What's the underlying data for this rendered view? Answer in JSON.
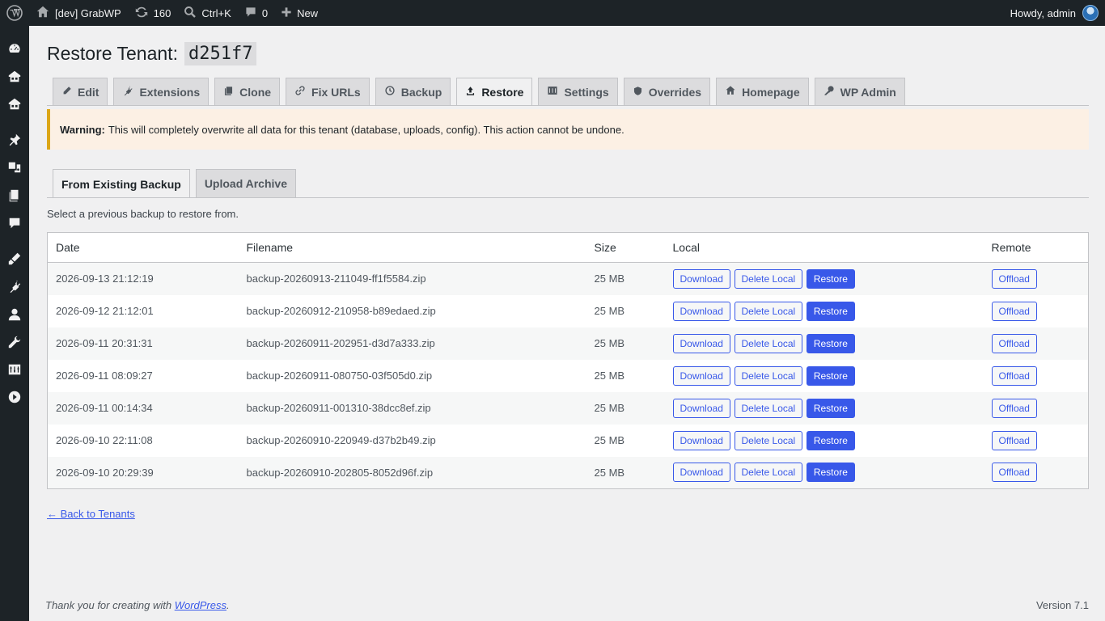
{
  "adminbar": {
    "site_name": "[dev] GrabWP",
    "updates_count": "160",
    "shortcut": "Ctrl+K",
    "comments_count": "0",
    "new_label": "New",
    "howdy": "Howdy, admin"
  },
  "page": {
    "title_prefix": "Restore Tenant:",
    "tenant_id": "d251f7"
  },
  "tabs": [
    {
      "label": "Edit",
      "icon": "pencil-icon"
    },
    {
      "label": "Extensions",
      "icon": "plugin-icon"
    },
    {
      "label": "Clone",
      "icon": "copy-icon"
    },
    {
      "label": "Fix URLs",
      "icon": "link-icon"
    },
    {
      "label": "Backup",
      "icon": "backup-icon"
    },
    {
      "label": "Restore",
      "icon": "upload-icon"
    },
    {
      "label": "Settings",
      "icon": "settings-icon"
    },
    {
      "label": "Overrides",
      "icon": "shield-icon"
    },
    {
      "label": "Homepage",
      "icon": "home-icon"
    },
    {
      "label": "WP Admin",
      "icon": "admin-key-icon"
    }
  ],
  "active_tab": "Restore",
  "notice": {
    "label": "Warning:",
    "text": "This will completely overwrite all data for this tenant (database, uploads, config). This action cannot be undone."
  },
  "subtabs": {
    "existing": "From Existing Backup",
    "upload": "Upload Archive"
  },
  "intro": "Select a previous backup to restore from.",
  "table": {
    "headers": {
      "date": "Date",
      "filename": "Filename",
      "size": "Size",
      "local": "Local",
      "remote": "Remote"
    },
    "buttons": {
      "download": "Download",
      "delete_local": "Delete Local",
      "restore": "Restore",
      "offload": "Offload"
    },
    "rows": [
      {
        "date": "2026-09-13 21:12:19",
        "filename": "backup-20260913-211049-ff1f5584.zip",
        "size": "25 MB"
      },
      {
        "date": "2026-09-12 21:12:01",
        "filename": "backup-20260912-210958-b89edaed.zip",
        "size": "25 MB"
      },
      {
        "date": "2026-09-11 20:31:31",
        "filename": "backup-20260911-202951-d3d7a333.zip",
        "size": "25 MB"
      },
      {
        "date": "2026-09-11 08:09:27",
        "filename": "backup-20260911-080750-03f505d0.zip",
        "size": "25 MB"
      },
      {
        "date": "2026-09-11 00:14:34",
        "filename": "backup-20260911-001310-38dcc8ef.zip",
        "size": "25 MB"
      },
      {
        "date": "2026-09-10 22:11:08",
        "filename": "backup-20260910-220949-d37b2b49.zip",
        "size": "25 MB"
      },
      {
        "date": "2026-09-10 20:29:39",
        "filename": "backup-20260910-202805-8052d96f.zip",
        "size": "25 MB"
      }
    ]
  },
  "back_link": "← Back to Tenants",
  "footer": {
    "thanks_prefix": "Thank you for creating with",
    "wordpress": "WordPress",
    "thanks_suffix": ".",
    "version": "Version 7.1"
  },
  "colors": {
    "accent": "#3858e9",
    "adminbar": "#1d2327",
    "warning_border": "#dba617"
  }
}
